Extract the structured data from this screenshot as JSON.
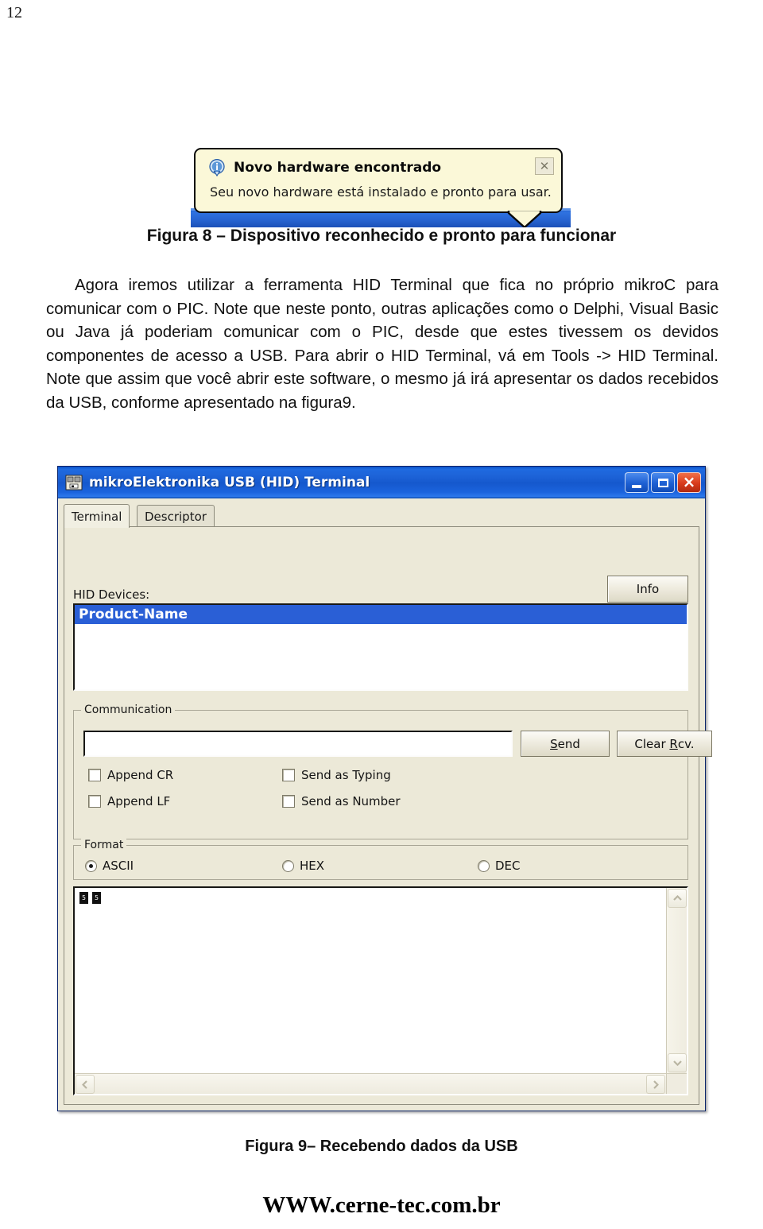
{
  "page": {
    "number": "12",
    "footer_url": "WWW.cerne-tec.com.br"
  },
  "balloon": {
    "title": "Novo hardware encontrado",
    "body": "Seu novo hardware está instalado e pronto para usar.",
    "close_label": "✕",
    "info_icon": "info-icon",
    "bg_color": "#fbf8d8",
    "border_color": "#0b0b0b"
  },
  "captions": {
    "figura8": "Figura 8 – Dispositivo reconhecido e pronto para funcionar",
    "figura9": "Figura 9– Recebendo dados da USB"
  },
  "paragraph": "Agora iremos utilizar a ferramenta HID Terminal que fica no próprio mikroC para comunicar com o PIC. Note que neste ponto, outras aplicações como o Delphi, Visual Basic ou Java já poderiam comunicar com o PIC, desde que estes tivessem os devidos componentes de acesso a USB. Para abrir o HID Terminal, vá em Tools -> HID Terminal. Note que assim que você abrir este software, o mesmo já irá apresentar os dados recebidos da USB, conforme apresentado na figura9.",
  "terminal_window": {
    "title": "mikroElektronika USB (HID) Terminal",
    "icon": "usb-device-icon",
    "titlebar_color": "#1558cd",
    "window_buttons": {
      "minimize": "minimize-button",
      "maximize": "maximize-button",
      "close": "close-button"
    },
    "tabs": [
      {
        "label": "Terminal",
        "active": true
      },
      {
        "label": "Descriptor",
        "active": false
      }
    ],
    "hid_devices": {
      "label": "HID Devices:",
      "items": [
        "Product-Name"
      ],
      "selected": "Product-Name",
      "selection_color": "#2a5fd6"
    },
    "info_button": "Info",
    "communication": {
      "group_title": "Communication",
      "send_input_value": "",
      "send_input_placeholder": "",
      "send_button": "Send",
      "clear_button": "Clear Rcv.",
      "checkboxes": [
        {
          "label": "Append CR",
          "checked": false
        },
        {
          "label": "Append LF",
          "checked": false
        },
        {
          "label": "Send as Typing",
          "checked": false
        },
        {
          "label": "Send as Number",
          "checked": false
        }
      ]
    },
    "format": {
      "group_title": "Format",
      "options": [
        {
          "label": "ASCII",
          "selected": true
        },
        {
          "label": "HEX",
          "selected": false
        },
        {
          "label": "DEC",
          "selected": false
        }
      ]
    },
    "receive_area": {
      "content_glyphs": [
        "▮",
        "▮"
      ],
      "scroll_up": "▲",
      "scroll_down": "▼",
      "scroll_left": "◀",
      "scroll_right": "▶"
    }
  }
}
